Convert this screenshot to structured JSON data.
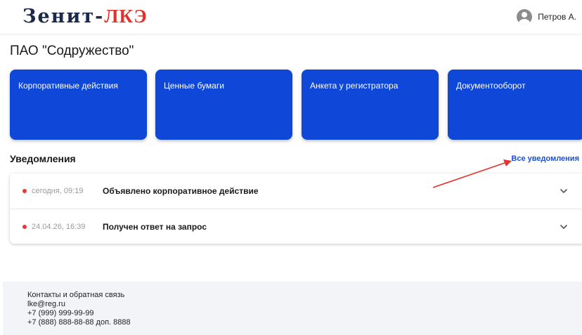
{
  "header": {
    "logo_part1": "Зенит-",
    "logo_part2": "ЛКЭ",
    "user_name": "Петров А.",
    "user_icon": "user-avatar-icon"
  },
  "company": {
    "name": "ПАО \"Содружество\""
  },
  "tiles": [
    {
      "label": "Корпоративные действия"
    },
    {
      "label": "Ценные бумаги"
    },
    {
      "label": "Анкета у регистратора"
    },
    {
      "label": "Документооборот"
    }
  ],
  "notifications": {
    "title": "Уведомления",
    "all_link": "Все уведомления",
    "items": [
      {
        "time": "сегодня, 09:19",
        "text": "Объявлено корпоративное действие",
        "unread": true
      },
      {
        "time": "24.04.26, 16:39",
        "text": "Получен ответ на запрос",
        "unread": true
      }
    ]
  },
  "footer": {
    "title": "Контакты и обратная связь",
    "email": "lke@reg.ru",
    "phone1": "+7 (999) 999-99-99",
    "phone2": "+7 (888) 888-88-88 доп. 8888"
  },
  "colors": {
    "tile_bg": "#0f47d8",
    "link": "#1a4fd6",
    "unread_dot": "#e53935",
    "annotation_arrow": "#e0332d",
    "logo_dark": "#1b2a4a",
    "logo_red": "#e0332d"
  }
}
